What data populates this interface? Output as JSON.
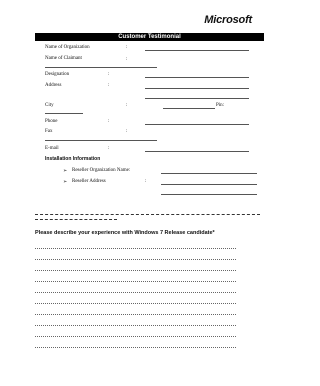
{
  "header": {
    "brand": "Microsoft",
    "banner_title": "Customer Testimonial"
  },
  "form": {
    "colon": ":",
    "fields": {
      "org_name": "Name of Organization",
      "claimant": "Name of Claimant",
      "designation": "Designation",
      "address": "Address",
      "city": "City",
      "pin": "Pin:",
      "phone": "Phone",
      "fax": "Fax",
      "email": "E-mail"
    },
    "installation": {
      "heading": "Installation Information",
      "bullet": "➢",
      "reseller_org": "Reseller Organization Name:",
      "reseller_address": "Reseller Address"
    },
    "experience_question": "Please describe your experience with Windows 7 Release candidate*"
  }
}
